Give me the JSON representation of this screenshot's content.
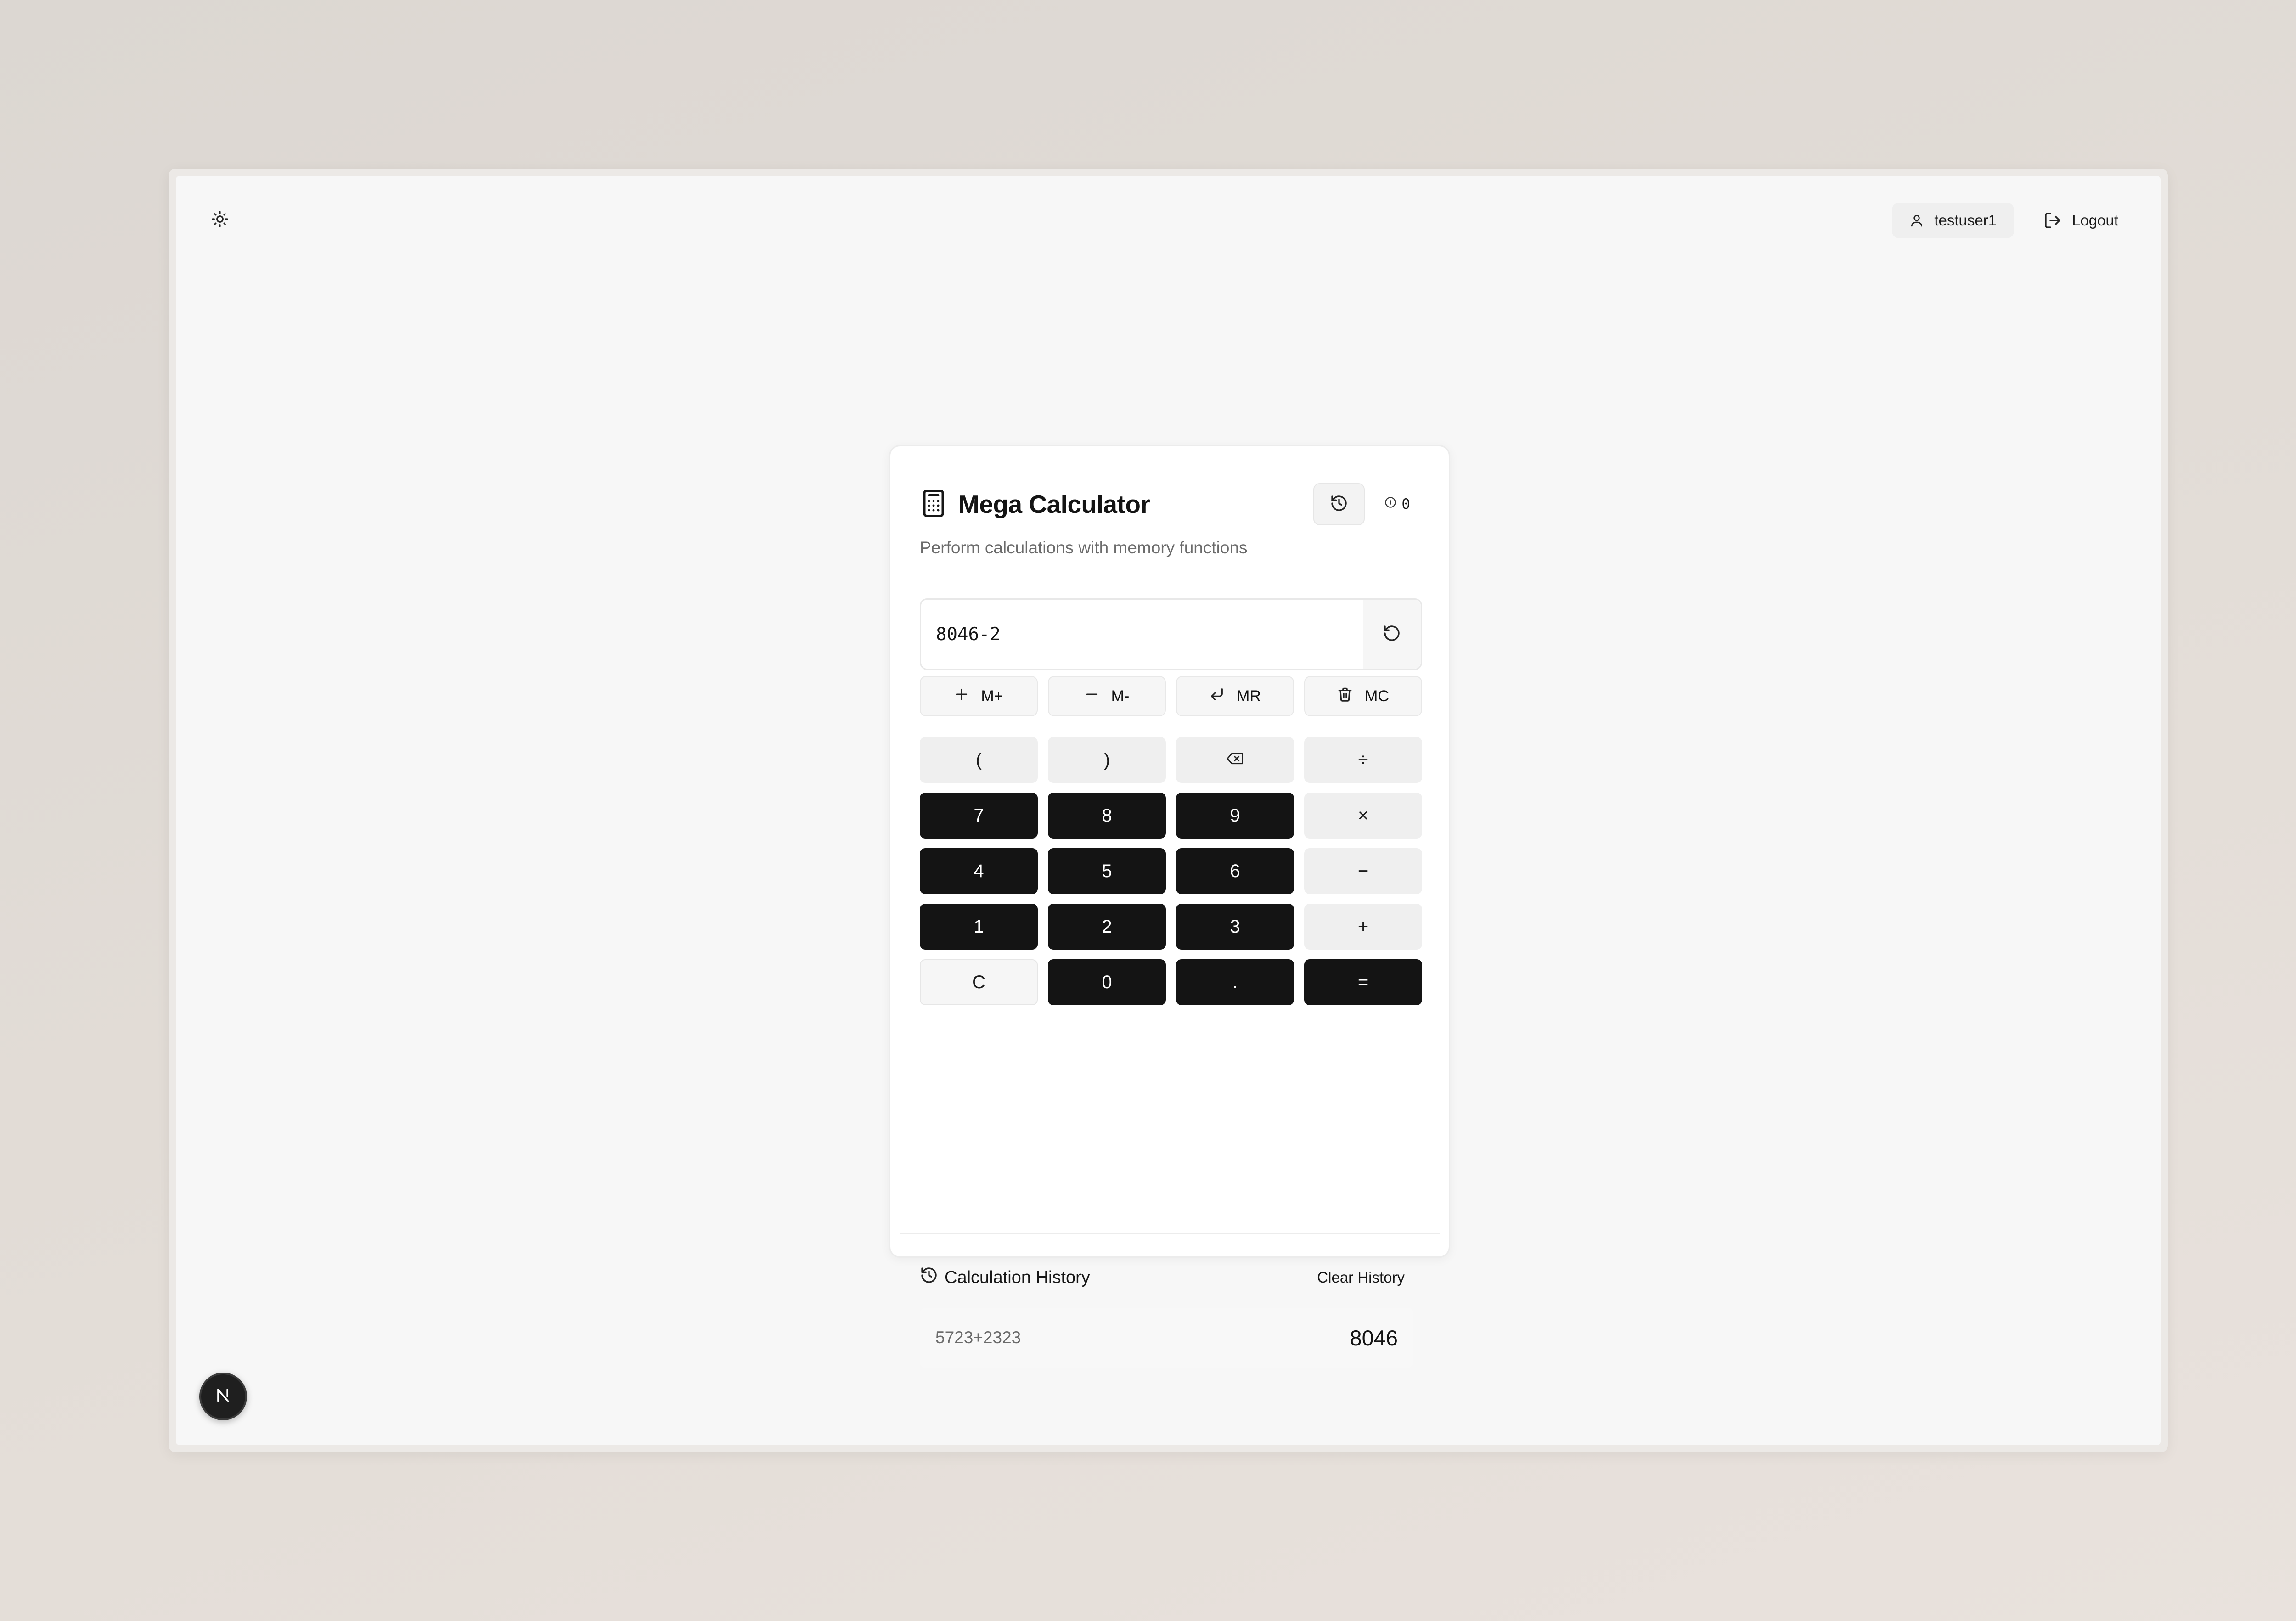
{
  "topbar": {
    "theme_icon": "sun-icon",
    "username": "testuser1",
    "logout_label": "Logout"
  },
  "calculator": {
    "title": "Mega Calculator",
    "subtitle": "Perform calculations with memory functions",
    "memory_value": "0",
    "display_value": "8046-2",
    "memory_buttons": [
      {
        "label": "M+",
        "icon": "plus-icon"
      },
      {
        "label": "M-",
        "icon": "minus-icon"
      },
      {
        "label": "MR",
        "icon": "return-icon"
      },
      {
        "label": "MC",
        "icon": "trash-icon"
      }
    ],
    "keys": [
      {
        "label": "(",
        "kind": "op",
        "name": "open-paren"
      },
      {
        "label": ")",
        "kind": "op",
        "name": "close-paren"
      },
      {
        "label": "",
        "kind": "op",
        "name": "backspace",
        "icon": "backspace-icon"
      },
      {
        "label": "÷",
        "kind": "op",
        "name": "divide"
      },
      {
        "label": "7",
        "kind": "num",
        "name": "7"
      },
      {
        "label": "8",
        "kind": "num",
        "name": "8"
      },
      {
        "label": "9",
        "kind": "num",
        "name": "9"
      },
      {
        "label": "×",
        "kind": "op",
        "name": "multiply"
      },
      {
        "label": "4",
        "kind": "num",
        "name": "4"
      },
      {
        "label": "5",
        "kind": "num",
        "name": "5"
      },
      {
        "label": "6",
        "kind": "num",
        "name": "6"
      },
      {
        "label": "−",
        "kind": "op",
        "name": "subtract"
      },
      {
        "label": "1",
        "kind": "num",
        "name": "1"
      },
      {
        "label": "2",
        "kind": "num",
        "name": "2"
      },
      {
        "label": "3",
        "kind": "num",
        "name": "3"
      },
      {
        "label": "+",
        "kind": "op",
        "name": "add"
      },
      {
        "label": "C",
        "kind": "clear",
        "name": "clear"
      },
      {
        "label": "0",
        "kind": "num",
        "name": "0"
      },
      {
        "label": ".",
        "kind": "num",
        "name": "decimal"
      },
      {
        "label": "=",
        "kind": "equals",
        "name": "equals"
      }
    ]
  },
  "history": {
    "title": "Calculation History",
    "clear_label": "Clear History",
    "items": [
      {
        "expression": "5723+2323",
        "result": "8046"
      }
    ]
  },
  "colors": {
    "key_dark": "#141414",
    "key_light": "#efefef",
    "background": "#f7f7f7"
  }
}
